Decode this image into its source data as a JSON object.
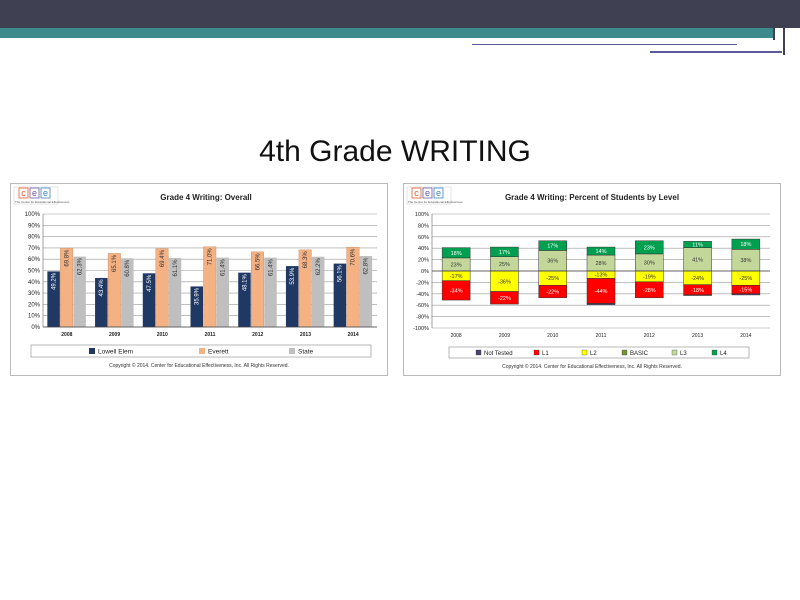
{
  "slide": {
    "title": "4th Grade WRITING"
  },
  "logo": {
    "letters": [
      "c",
      "e",
      "e"
    ],
    "letter_colors": [
      "#e4582b",
      "#6a5aa8",
      "#3a86c8"
    ],
    "tagline": "The Center for Educational Effectiveness"
  },
  "copyright": "Copyright © 2014. Center for Educational Effectiveness, Inc. All Rights Reserved.",
  "colors": {
    "lowell": "#1f3864",
    "everett": "#f4b183",
    "state": "#bfbfbf",
    "not_tested": "#4a4070",
    "l1": "#ff0000",
    "l2": "#ffff00",
    "basic": "#76923c",
    "l3": "#c4d79b",
    "l4": "#00a050"
  },
  "chart_data": [
    {
      "type": "bar",
      "title": "Grade 4 Writing: Overall",
      "categories": [
        "2008",
        "2009",
        "2010",
        "2011",
        "2012",
        "2013",
        "2014"
      ],
      "ylim": [
        0,
        100
      ],
      "yticks": [
        "0%",
        "10%",
        "20%",
        "30%",
        "40%",
        "50%",
        "60%",
        "70%",
        "80%",
        "90%",
        "100%"
      ],
      "series": [
        {
          "name": "Lowell Elem",
          "values": [
            49.2,
            43.4,
            47.5,
            35.9,
            48.1,
            53.9,
            56.1
          ],
          "labels": [
            "49.2%",
            "43.4%",
            "47.5%",
            "35.9%",
            "48.1%",
            "53.9%",
            "56.1%"
          ]
        },
        {
          "name": "Everett",
          "values": [
            69.8,
            65.1,
            69.4,
            71.0,
            66.5,
            68.3,
            70.6
          ],
          "labels": [
            "69.8%",
            "65.1%",
            "69.4%",
            "71.0%",
            "66.5%",
            "68.3%",
            "70.6%"
          ]
        },
        {
          "name": "State",
          "values": [
            62.3,
            60.8,
            61.1,
            61.4,
            61.4,
            62.2,
            62.8
          ],
          "labels": [
            "62.3%",
            "60.8%",
            "61.1%",
            "61.4%",
            "61.4%",
            "62.2%",
            "62.8%"
          ]
        }
      ],
      "legend": "bottom",
      "grid": true
    },
    {
      "type": "bar",
      "stacked": true,
      "title": "Grade 4 Writing: Percent of Students by Level",
      "categories": [
        "2008",
        "2009",
        "2010",
        "2011",
        "2012",
        "2013",
        "2014"
      ],
      "ylim": [
        -100,
        100
      ],
      "yticks": [
        "-100%",
        "-80%",
        "-60%",
        "-40%",
        "-20%",
        "0%",
        "20%",
        "40%",
        "60%",
        "80%",
        "100%"
      ],
      "series": [
        {
          "name": "Not Tested",
          "values": [
            0,
            0,
            0,
            -2,
            0,
            -1,
            -2
          ],
          "labels": [
            "",
            "",
            "",
            "",
            "",
            "",
            ""
          ]
        },
        {
          "name": "L1",
          "values": [
            -34,
            -22,
            -22,
            -44,
            -28,
            -18,
            -15
          ],
          "labels": [
            "-34%",
            "-22%",
            "-22%",
            "-44%",
            "-28%",
            "-18%",
            "-15%"
          ]
        },
        {
          "name": "L2",
          "values": [
            -17,
            -36,
            -25,
            -13,
            -19,
            -24,
            -25
          ],
          "labels": [
            "-17%",
            "-36%",
            "-25%",
            "-13%",
            "-19%",
            "-24%",
            "-25%"
          ]
        },
        {
          "name": "BASIC",
          "values": [
            0,
            0,
            0,
            0,
            0,
            0,
            0
          ],
          "labels": [
            "",
            "",
            "",
            "",
            "",
            "",
            ""
          ]
        },
        {
          "name": "L3",
          "values": [
            23,
            25,
            36,
            28,
            30,
            41,
            38
          ],
          "labels": [
            "23%",
            "25%",
            "36%",
            "28%",
            "30%",
            "41%",
            "38%"
          ]
        },
        {
          "name": "L4",
          "values": [
            18,
            17,
            17,
            14,
            23,
            11,
            18
          ],
          "labels": [
            "18%",
            "17%",
            "17%",
            "14%",
            "23%",
            "11%",
            "18%"
          ]
        }
      ],
      "legend": "bottom",
      "grid": true
    }
  ]
}
